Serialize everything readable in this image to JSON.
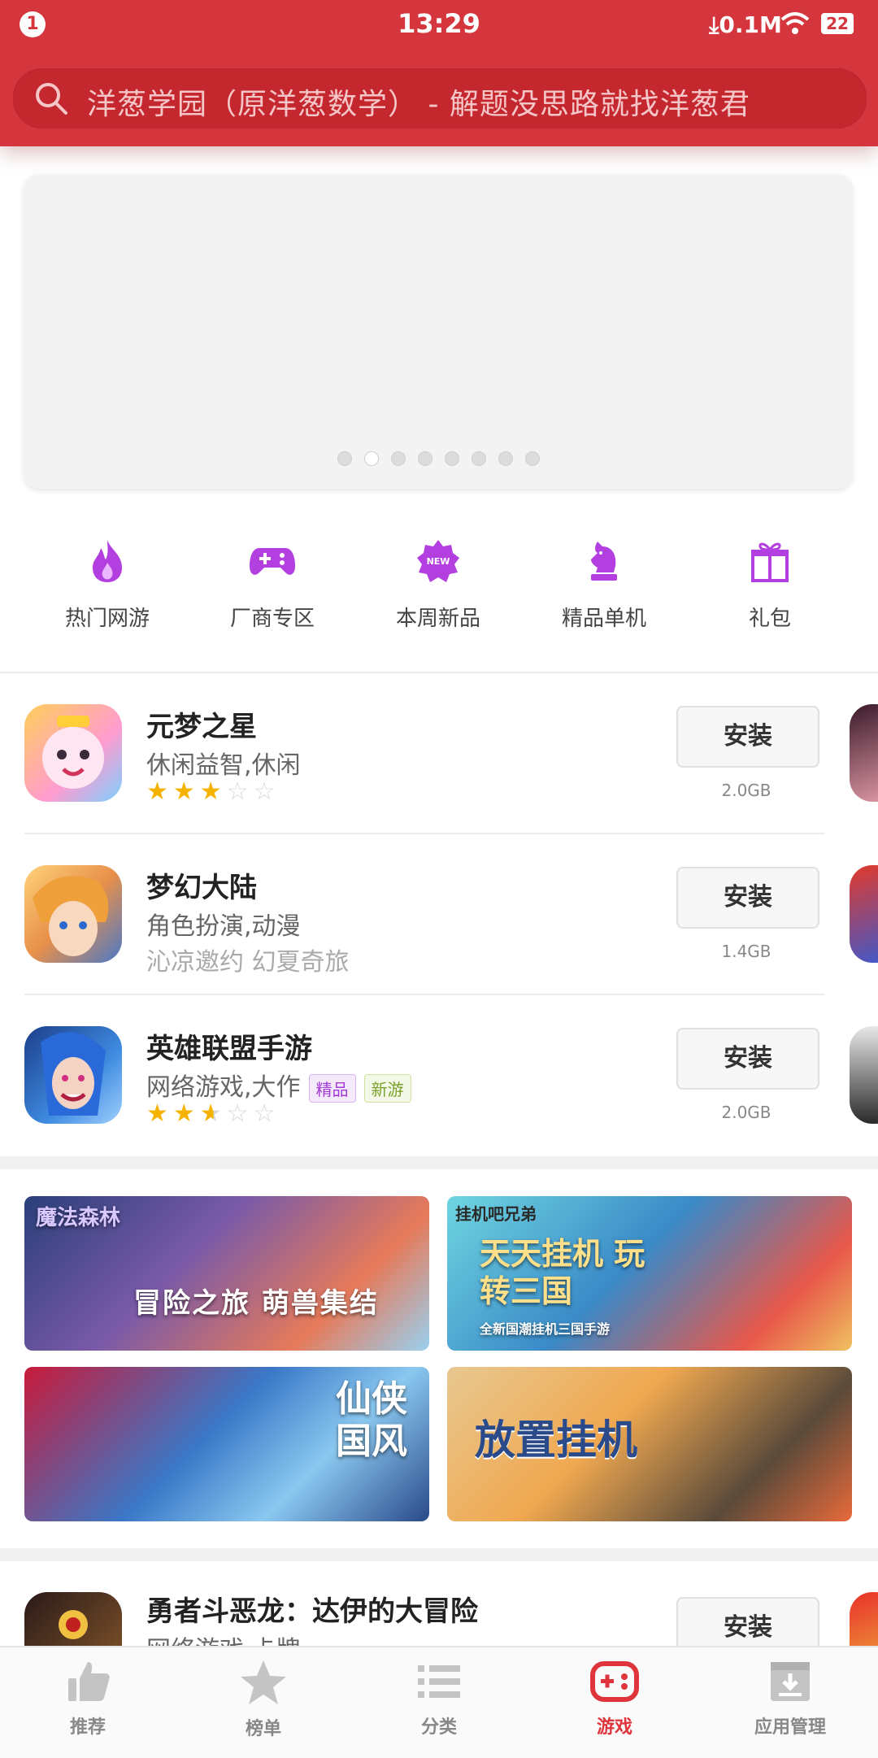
{
  "status_bar": {
    "time": "13:29",
    "notification": "1",
    "speed": "0.1M",
    "battery": "22"
  },
  "search": {
    "placeholder": "洋葱学园（原洋葱数学） - 解题没思路就找洋葱君"
  },
  "banner": {
    "page_count": 8,
    "active_page": 2
  },
  "categories": [
    {
      "label": "热门网游",
      "icon": "flame-icon"
    },
    {
      "label": "厂商专区",
      "icon": "gamepad-icon"
    },
    {
      "label": "本周新品",
      "icon": "new-badge-icon"
    },
    {
      "label": "精品单机",
      "icon": "chess-knight-icon"
    },
    {
      "label": "礼包",
      "icon": "gift-icon"
    }
  ],
  "apps": [
    {
      "name": "元梦之星",
      "tags": "休闲益智,休闲",
      "rating": 3,
      "button": "安装",
      "size": "2.0GB"
    },
    {
      "name": "梦幻大陆",
      "tags": "角色扮演,动漫",
      "slogan": "沁凉邀约 幻夏奇旅",
      "button": "安装",
      "size": "1.4GB"
    },
    {
      "name": "英雄联盟手游",
      "tags": "网络游戏,大作",
      "badges": [
        "精品",
        "新游"
      ],
      "rating": 2.5,
      "button": "安装",
      "size": "2.0GB"
    }
  ],
  "promos": [
    {
      "caption": "冒险之旅 萌兽集结",
      "top_text": "魔法森林"
    },
    {
      "caption": "天天挂机 玩转三国",
      "top_text": "挂机吧兄弟",
      "sub_text": "全新国潮挂机三国手游"
    },
    {
      "caption": "仙侠国风"
    },
    {
      "caption": "放置挂机"
    }
  ],
  "next_app": {
    "name": "勇者斗恶龙：达伊的大冒险",
    "tags": "网络游戏,卡牌",
    "button": "安装"
  },
  "bottom_nav": [
    {
      "label": "推荐",
      "icon": "thumbs-up-icon"
    },
    {
      "label": "榜单",
      "icon": "star-icon"
    },
    {
      "label": "分类",
      "icon": "list-icon"
    },
    {
      "label": "游戏",
      "icon": "gamepad-icon",
      "active": true
    },
    {
      "label": "应用管理",
      "icon": "download-box-icon"
    }
  ],
  "colors": {
    "brand_red": "#d5353c",
    "accent_purple": "#a23bd6",
    "star": "#f5b300"
  }
}
